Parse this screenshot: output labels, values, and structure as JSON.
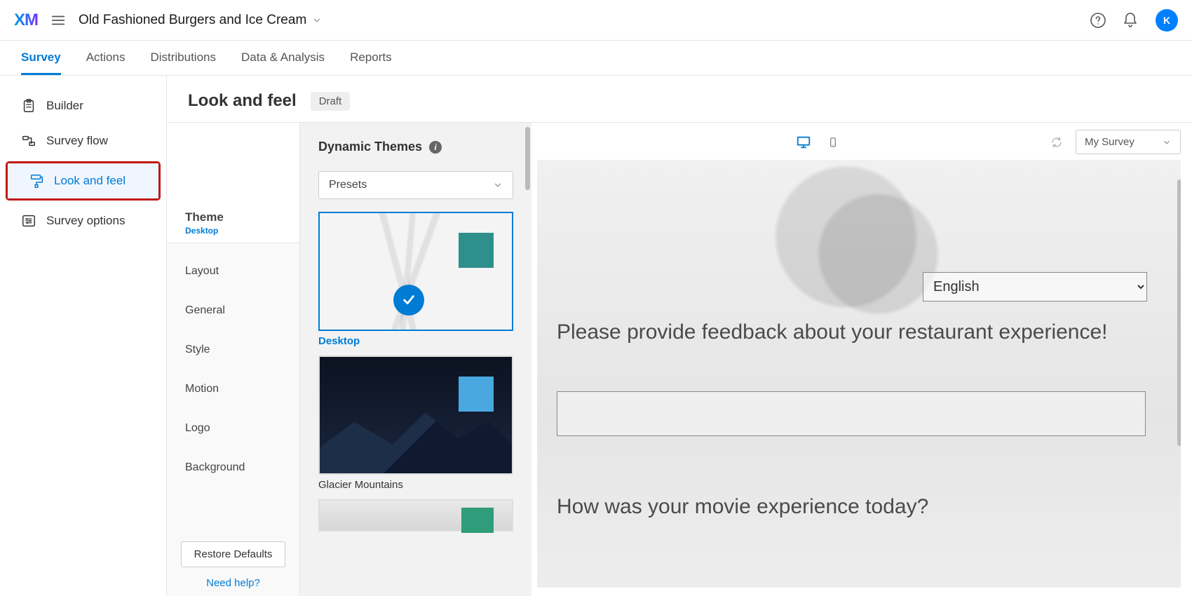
{
  "header": {
    "logo": "XM",
    "project_name": "Old Fashioned Burgers and Ice Cream",
    "avatar_initial": "K"
  },
  "tabs": {
    "items": [
      "Survey",
      "Actions",
      "Distributions",
      "Data & Analysis",
      "Reports"
    ],
    "active_index": 0
  },
  "leftnav": {
    "items": [
      {
        "label": "Builder"
      },
      {
        "label": "Survey flow"
      },
      {
        "label": "Look and feel"
      },
      {
        "label": "Survey options"
      }
    ],
    "active_index": 2,
    "highlight_index": 2
  },
  "page": {
    "title": "Look and feel",
    "status": "Draft"
  },
  "settings": {
    "active": {
      "label": "Theme",
      "sublabel": "Desktop"
    },
    "items": [
      "Layout",
      "General",
      "Style",
      "Motion",
      "Logo",
      "Background"
    ],
    "restore": "Restore Defaults",
    "help": "Need help?"
  },
  "themes": {
    "heading": "Dynamic Themes",
    "dropdown": "Presets",
    "list": [
      {
        "name": "Desktop",
        "selected": true,
        "swatch": "#2f8f8b"
      },
      {
        "name": "Glacier Mountains",
        "selected": false,
        "swatch": "#4aa8e0"
      },
      {
        "name": "",
        "selected": false,
        "swatch": "#2f9d7a"
      }
    ]
  },
  "preview": {
    "survey_dropdown": "My Survey",
    "language": "English",
    "q1": "Please provide feedback about your restaurant experience!",
    "q2": "How was your movie experience today?"
  }
}
